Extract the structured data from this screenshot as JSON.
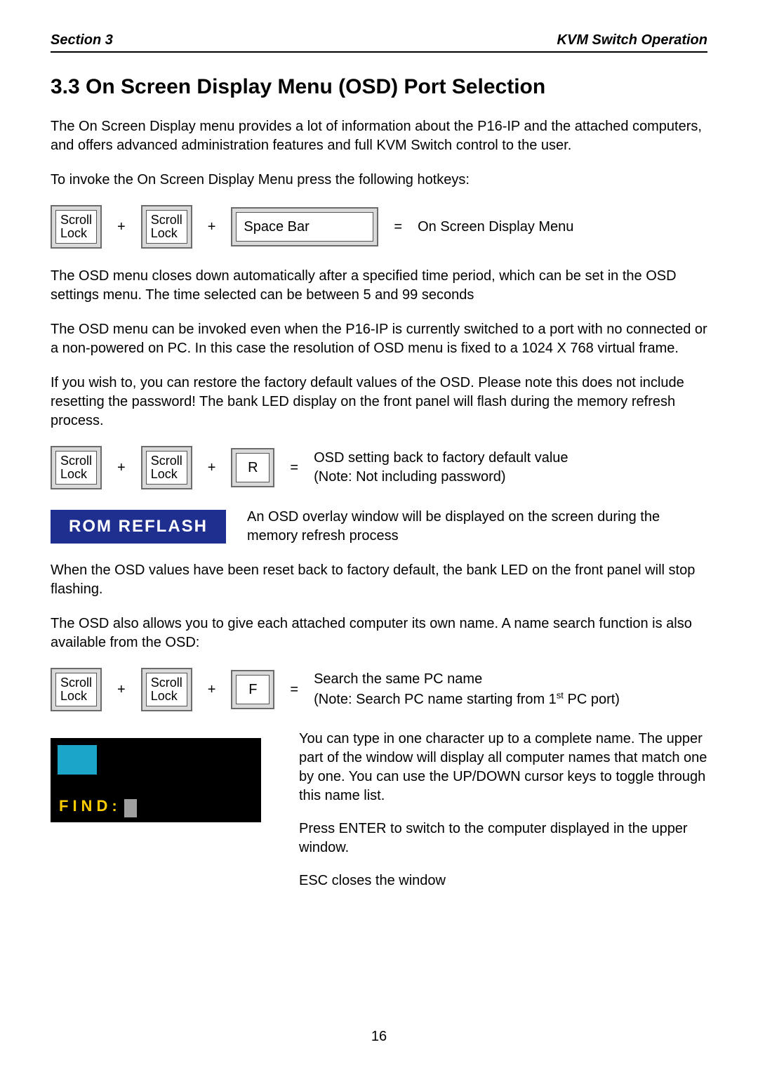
{
  "header": {
    "left": "Section 3",
    "right": "KVM Switch Operation"
  },
  "title": "3.3  On Screen Display Menu (OSD) Port Selection",
  "para1": "The On Screen Display menu provides a lot of information about the P16-IP and the attached computers, and offers advanced administration features and full KVM Switch control to the user.",
  "para2": "To invoke the On Screen Display Menu press the following hotkeys:",
  "keys": {
    "scroll1": "Scroll",
    "lock1": "Lock",
    "scroll2": "Scroll",
    "lock2": "Lock",
    "space": "Space Bar",
    "r": "R",
    "f": "F",
    "plus": "+",
    "equals": "="
  },
  "row1_result": "On Screen Display Menu",
  "para3": "The OSD menu closes down automatically after a specified time period, which can be set in the OSD settings menu. The time selected can be between 5 and 99 seconds",
  "para4": "The OSD menu can be invoked even when the P16-IP is currently switched to a port with no connected or a non-powered on PC. In this case the resolution of OSD menu is fixed to a 1024 X 768 virtual frame.",
  "para5": "If you wish to, you can restore the factory default values of the OSD. Please note this does not include resetting the password! The bank LED display on the front panel will flash during the memory refresh process.",
  "row2_result_line1": "OSD setting back to factory default value",
  "row2_result_line2": "(Note: Not including password)",
  "reflash_label": "ROM  REFLASH",
  "reflash_text": "An OSD overlay window will be displayed on the screen during the memory refresh process",
  "para6": "When the OSD values have been reset back to factory default, the bank LED on the front panel will stop flashing.",
  "para7": "The OSD also allows you to give each attached computer its own name. A name search function is also available from the OSD:",
  "row3_result_line1": "Search the same PC name",
  "row3_result_line2a": "(Note: Search PC name starting from 1",
  "row3_result_line2b": "st",
  "row3_result_line2c": " PC port)",
  "find_label": "FIND:",
  "find_para1": "You can type in one character up to a complete name. The upper part of the window will display all computer names that match one by one. You can use the UP/DOWN cursor keys to toggle through this name list.",
  "find_para2": "Press ENTER to switch to the computer displayed in the upper window.",
  "find_para3": "ESC closes the window",
  "page_number": "16"
}
